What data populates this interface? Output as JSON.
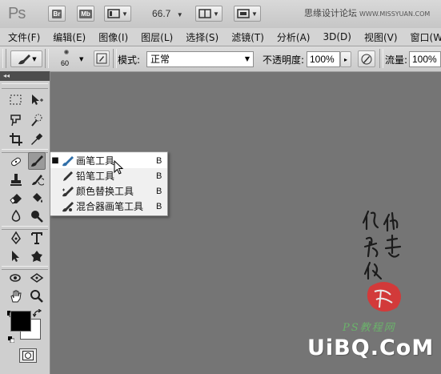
{
  "titlebar": {
    "app_logo": "Ps",
    "bridge_label": "Br",
    "minibridge_label": "Mb",
    "zoom_value": "66.7",
    "site_watermark": "思缘设计论坛",
    "site_url": "WWW.MISSYUAN.COM"
  },
  "menu": {
    "items": [
      "文件(F)",
      "编辑(E)",
      "图像(I)",
      "图层(L)",
      "选择(S)",
      "滤镜(T)",
      "分析(A)",
      "3D(D)",
      "视图(V)",
      "窗口(W)"
    ]
  },
  "options": {
    "brush_size": "60",
    "mode_label": "模式:",
    "mode_value": "正常",
    "opacity_label": "不透明度:",
    "opacity_value": "100%",
    "flow_label": "流量:",
    "flow_value": "100%"
  },
  "tools_panel": {
    "collapse_glyph": "◂◂"
  },
  "flyout": {
    "items": [
      {
        "label": "画笔工具",
        "shortcut": "B",
        "selected": true,
        "icon": "brush-icon"
      },
      {
        "label": "铅笔工具",
        "shortcut": "B",
        "selected": false,
        "icon": "pencil-icon"
      },
      {
        "label": "颜色替换工具",
        "shortcut": "B",
        "selected": false,
        "icon": "color-replacement-icon"
      },
      {
        "label": "混合器画笔工具",
        "shortcut": "B",
        "selected": false,
        "icon": "mixer-brush-icon"
      }
    ],
    "bullet": "■"
  },
  "canvas": {
    "seal_label": "PS教程网",
    "brand_logo": "UiBQ.CoM"
  },
  "colors": {
    "canvas_bg": "#757575",
    "foreground": "#000000",
    "background": "#ffffff",
    "seal_red": "#d23a3a",
    "seal_text_green": "#6bb26b"
  }
}
